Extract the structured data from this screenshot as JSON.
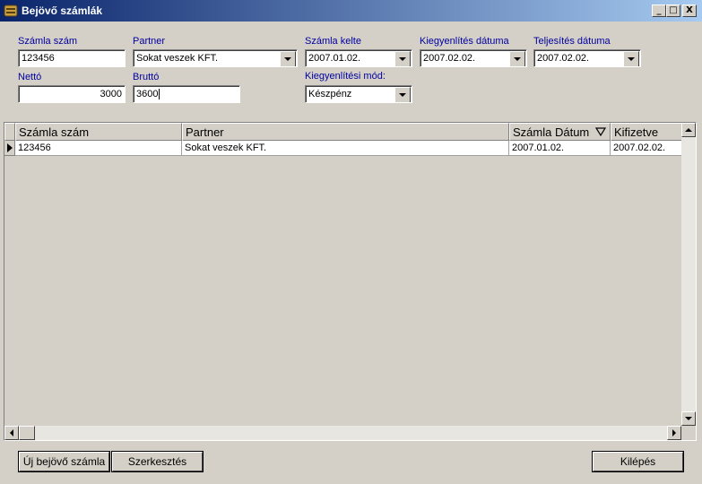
{
  "window": {
    "title": "Bejövő számlák",
    "buttons": {
      "minimize": "_",
      "maximize": "□",
      "close": "X"
    }
  },
  "form": {
    "szamla_szam": {
      "label": "Számla szám",
      "value": "123456"
    },
    "partner": {
      "label": "Partner",
      "value": "Sokat veszek KFT."
    },
    "szamla_kelte": {
      "label": "Számla kelte",
      "value": "2007.01.02."
    },
    "kiegyenlites_datuma": {
      "label": "Kiegyenlítés dátuma",
      "value": "2007.02.02."
    },
    "teljesites_datuma": {
      "label": "Teljesítés dátuma",
      "value": "2007.02.02."
    },
    "netto": {
      "label": "Nettó",
      "value": "3000"
    },
    "brutto": {
      "label": "Bruttó",
      "value": "3600"
    },
    "kiegyenlitesi_mod": {
      "label": "Kiegyenlítési mód:",
      "value": "Készpénz"
    }
  },
  "grid": {
    "columns": [
      "Számla szám",
      "Partner",
      "Számla Dátum",
      "Kifizetve"
    ],
    "rows": [
      [
        "123456",
        "Sokat veszek KFT.",
        "2007.01.02.",
        "2007.02.02."
      ]
    ]
  },
  "buttons": {
    "new": "Új bejövő számla",
    "edit": "Szerkesztés",
    "exit": "Kilépés"
  }
}
